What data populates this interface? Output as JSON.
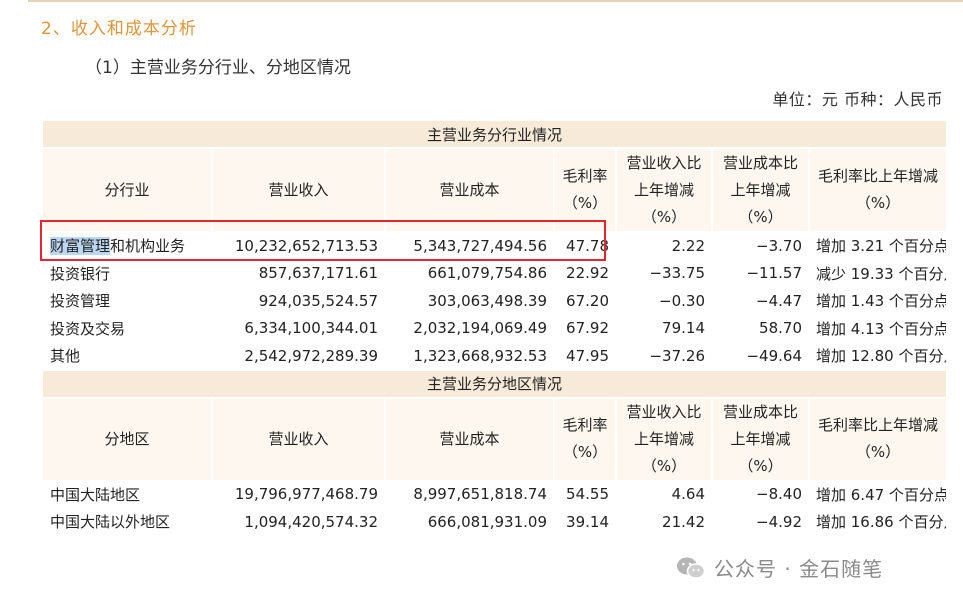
{
  "section_title": "2、收入和成本分析",
  "subsection_title": "（1）主营业务分行业、分地区情况",
  "unit_line": "单位：元  币种：人民币",
  "table_industry": {
    "band": "主营业务分行业情况",
    "headers": [
      "分行业",
      "营业收入",
      "营业成本",
      "毛利率\n（%）",
      "营业收入比\n上年增减\n（%）",
      "营业成本比\n上年增减\n（%）",
      "毛利率比上年增减\n（%）"
    ],
    "first_name_highlight": "财富管理",
    "first_name_rest": "和机构业务",
    "rows": [
      {
        "name": "财富管理和机构业务",
        "revenue": "10,232,652,713.53",
        "cost": "5,343,727,494.56",
        "margin": "47.78",
        "rev_chg": "2.22",
        "cost_chg": "−3.70",
        "margin_chg": "增加 3.21 个百分点"
      },
      {
        "name": "投资银行",
        "revenue": "857,637,171.61",
        "cost": "661,079,754.86",
        "margin": "22.92",
        "rev_chg": "−33.75",
        "cost_chg": "−11.57",
        "margin_chg": "减少 19.33 个百分点"
      },
      {
        "name": "投资管理",
        "revenue": "924,035,524.57",
        "cost": "303,063,498.39",
        "margin": "67.20",
        "rev_chg": "−0.30",
        "cost_chg": "−4.47",
        "margin_chg": "增加 1.43 个百分点"
      },
      {
        "name": "投资及交易",
        "revenue": "6,334,100,344.01",
        "cost": "2,032,194,069.49",
        "margin": "67.92",
        "rev_chg": "79.14",
        "cost_chg": "58.70",
        "margin_chg": "增加 4.13 个百分点"
      },
      {
        "name": "其他",
        "revenue": "2,542,972,289.39",
        "cost": "1,323,668,932.53",
        "margin": "47.95",
        "rev_chg": "−37.26",
        "cost_chg": "−49.64",
        "margin_chg": "增加 12.80 个百分点"
      }
    ]
  },
  "table_region": {
    "band": "主营业务分地区情况",
    "headers": [
      "分地区",
      "营业收入",
      "营业成本",
      "毛利率\n（%）",
      "营业收入比\n上年增减\n（%）",
      "营业成本比\n上年增减\n（%）",
      "毛利率比上年增减\n（%）"
    ],
    "rows": [
      {
        "name": "中国大陆地区",
        "revenue": "19,796,977,468.79",
        "cost": "8,997,651,818.74",
        "margin": "54.55",
        "rev_chg": "4.64",
        "cost_chg": "−8.40",
        "margin_chg": "增加 6.47 个百分点"
      },
      {
        "name": "中国大陆以外地区",
        "revenue": "1,094,420,574.32",
        "cost": "666,081,931.09",
        "margin": "39.14",
        "rev_chg": "21.42",
        "cost_chg": "−4.92",
        "margin_chg": "增加 16.86 个百分点"
      }
    ]
  },
  "watermark": "公众号 · 金石随笔"
}
